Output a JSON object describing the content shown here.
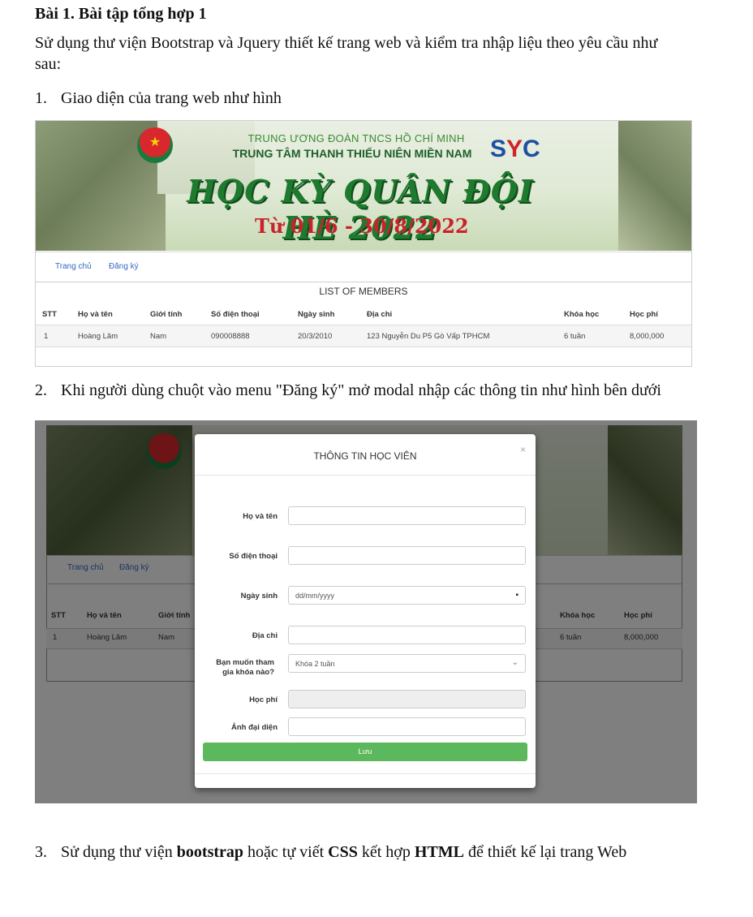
{
  "doc": {
    "title": "Bài 1. Bài tập tổng hợp 1",
    "intro": "Sử dụng thư viện Bootstrap và Jquery thiết kế trang web và kiểm tra nhập liệu theo yêu cầu như sau:",
    "item1_num": "1.",
    "item1": "Giao diện của trang web như hình",
    "item2_num": "2.",
    "item2": "Khi người dùng chuột vào menu \"Đăng ký\" mở modal nhập các thông tin như hình bên dưới",
    "item3_num": "3.",
    "item3_pre": "Sử dụng thư viện ",
    "item3_b1": "bootstrap",
    "item3_mid1": " hoặc tự viết ",
    "item3_b2": "CSS",
    "item3_mid2": " kết hợp ",
    "item3_b3": "HTML",
    "item3_post": " để thiết kế lại trang Web"
  },
  "banner": {
    "line1": "TRUNG ƯƠNG ĐOÀN TNCS HỒ CHÍ MINH",
    "line2": "TRUNG TÂM THANH THIẾU NIÊN MIỀN NAM",
    "brand_s": "S",
    "brand_y": "Y",
    "brand_c": "C",
    "title": "HỌC KỲ QUÂN ĐỘI HÈ 2022",
    "dates": "Từ 01/6 - 30/8/2022"
  },
  "nav": {
    "home": "Trang chủ",
    "register": "Đăng ký"
  },
  "table": {
    "title": "LIST OF MEMBERS",
    "headers": [
      "STT",
      "Họ và tên",
      "Giới tính",
      "Số điện thoại",
      "Ngày sinh",
      "Địa chỉ",
      "Khóa học",
      "Học phí"
    ],
    "rows": [
      [
        "1",
        "Hoàng Lâm",
        "Nam",
        "090008888",
        "20/3/2010",
        "123 Nguyễn Du P5 Gò Vấp TPHCM",
        "6 tuần",
        "8,000,000"
      ]
    ]
  },
  "modal": {
    "title": "THÔNG TIN HỌC VIÊN",
    "close": "×",
    "fields": {
      "name_label": "Họ và tên",
      "phone_label": "Số điện thoại",
      "dob_label": "Ngày sinh",
      "dob_placeholder": "dd/mm/yyyy",
      "address_label": "Địa chỉ",
      "course_label": "Bạn muốn tham gia khóa nào?",
      "course_value": "Khóa 2 tuần",
      "fee_label": "Học phí",
      "avatar_label": "Ảnh đại diện"
    },
    "save": "Lưu"
  },
  "colors": {
    "accent_green": "#5cb85c",
    "link_blue": "#3468c2",
    "banner_red": "#c9222a",
    "banner_green": "#1e7a2e"
  },
  "icons": {
    "calendar": "calendar-icon",
    "chevron": "chevron-down-icon",
    "close": "close-icon"
  }
}
